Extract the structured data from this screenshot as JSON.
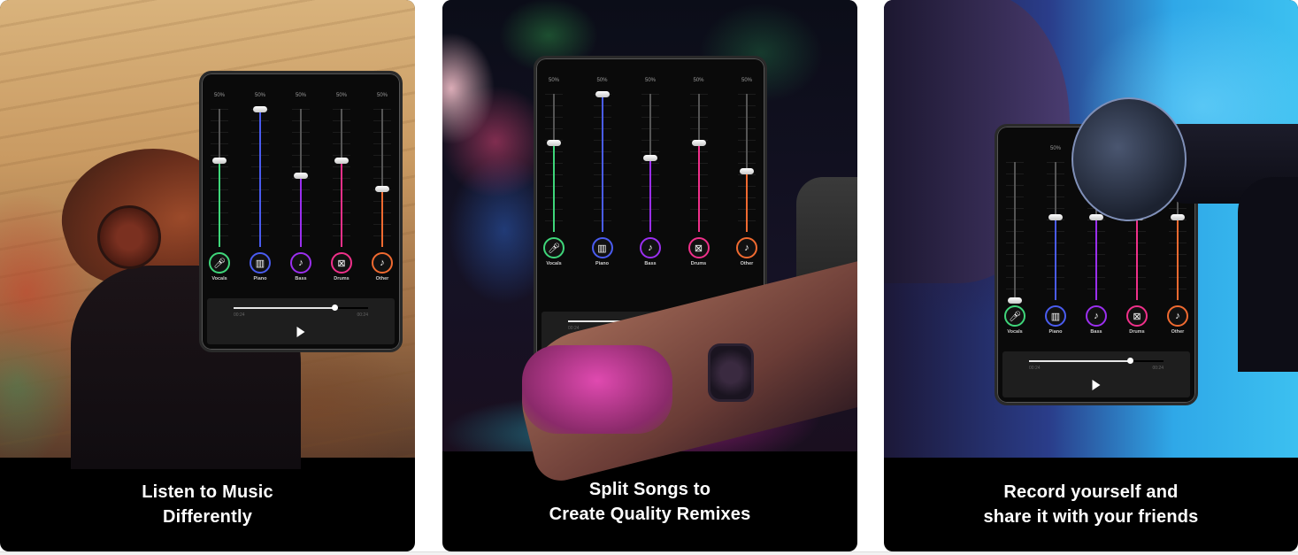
{
  "screenshots": [
    {
      "caption_lines": [
        "Listen to Music",
        "Differently"
      ],
      "scene": "man-with-headphones",
      "mixer": {
        "channels": [
          {
            "label": "Vocals",
            "percent_label": "50%",
            "level": 0.63,
            "color": "#3fd67a",
            "icon": "microphone-icon"
          },
          {
            "label": "Piano",
            "percent_label": "50%",
            "level": 1.0,
            "color": "#4a5cf0",
            "icon": "piano-icon"
          },
          {
            "label": "Bass",
            "percent_label": "50%",
            "level": 0.52,
            "color": "#9b2ff0",
            "icon": "guitar-icon"
          },
          {
            "label": "Drums",
            "percent_label": "50%",
            "level": 0.63,
            "color": "#f0308a",
            "icon": "drum-icon"
          },
          {
            "label": "Other",
            "percent_label": "50%",
            "level": 0.42,
            "color": "#f06a30",
            "icon": "music-note-icon"
          }
        ],
        "player": {
          "progress": 0.75,
          "time_elapsed": "00:24",
          "time_total": "00:24"
        }
      }
    },
    {
      "caption_lines": [
        "Split Songs to",
        "Create Quality Remixes"
      ],
      "scene": "dj-at-mixer",
      "mixer": {
        "channels": [
          {
            "label": "Vocals",
            "percent_label": "50%",
            "level": 0.65,
            "color": "#3fd67a",
            "icon": "microphone-icon"
          },
          {
            "label": "Piano",
            "percent_label": "50%",
            "level": 1.0,
            "color": "#4a5cf0",
            "icon": "piano-icon"
          },
          {
            "label": "Bass",
            "percent_label": "50%",
            "level": 0.54,
            "color": "#9b2ff0",
            "icon": "guitar-icon"
          },
          {
            "label": "Drums",
            "percent_label": "50%",
            "level": 0.65,
            "color": "#f0308a",
            "icon": "drum-icon"
          },
          {
            "label": "Other",
            "percent_label": "50%",
            "level": 0.44,
            "color": "#f06a30",
            "icon": "music-note-icon"
          }
        ],
        "player": {
          "progress": 0.75,
          "time_elapsed": "00:24",
          "time_total": ""
        }
      }
    },
    {
      "caption_lines": [
        "Record yourself and",
        "share it with your friends"
      ],
      "scene": "singer-with-microphone",
      "mixer": {
        "channels": [
          {
            "label": "Vocals",
            "percent_label": "",
            "level": 0.0,
            "color": "#3fd67a",
            "icon": "microphone-icon"
          },
          {
            "label": "Piano",
            "percent_label": "50%",
            "level": 0.6,
            "color": "#4a5cf0",
            "icon": "piano-icon"
          },
          {
            "label": "Bass",
            "percent_label": "",
            "level": 0.6,
            "color": "#9b2ff0",
            "icon": "guitar-icon"
          },
          {
            "label": "Drums",
            "percent_label": "",
            "level": 0.6,
            "color": "#f0308a",
            "icon": "drum-icon"
          },
          {
            "label": "Other",
            "percent_label": "",
            "level": 0.6,
            "color": "#f06a30",
            "icon": "music-note-icon"
          }
        ],
        "player": {
          "progress": 0.75,
          "time_elapsed": "00:24",
          "time_total": "00:24"
        }
      }
    }
  ],
  "icon_glyphs": {
    "microphone-icon": "🎤︎",
    "piano-icon": "▥",
    "guitar-icon": "♪",
    "drum-icon": "⊠",
    "music-note-icon": "♪"
  }
}
